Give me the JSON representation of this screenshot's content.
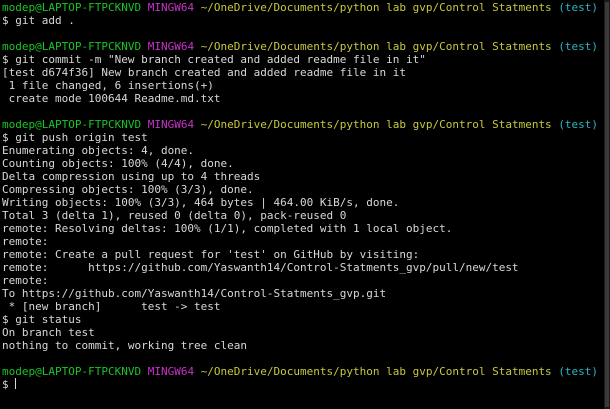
{
  "prompt": {
    "user_host": "modep@LAPTOP-FTPCKNVD",
    "shell": "MINGW64",
    "path": "~/OneDrive/Documents/python lab gvp/Control Statments",
    "branch": "(test)",
    "symbol": "$"
  },
  "blocks": [
    {
      "command": "git add .",
      "output": []
    },
    {
      "command": "git commit -m \"New branch created and added readme file in it\"",
      "output": [
        "[test d674f36] New branch created and added readme file in it",
        " 1 file changed, 6 insertions(+)",
        " create mode 100644 Readme.md.txt"
      ]
    },
    {
      "command": "git push origin test",
      "output": [
        "Enumerating objects: 4, done.",
        "Counting objects: 100% (4/4), done.",
        "Delta compression using up to 4 threads",
        "Compressing objects: 100% (3/3), done.",
        "Writing objects: 100% (3/3), 464 bytes | 464.00 KiB/s, done.",
        "Total 3 (delta 1), reused 0 (delta 0), pack-reused 0",
        "remote: Resolving deltas: 100% (1/1), completed with 1 local object.",
        "remote:",
        "remote: Create a pull request for 'test' on GitHub by visiting:",
        "remote:      https://github.com/Yaswanth14/Control-Statments_gvp/pull/new/test",
        "remote:",
        "To https://github.com/Yaswanth14/Control-Statments_gvp.git",
        " * [new branch]      test -> test"
      ]
    },
    {
      "command": "git status",
      "output": [
        "On branch test",
        "nothing to commit, working tree clean"
      ]
    }
  ],
  "colors": {
    "background": "#000000",
    "user_host": "#17c527",
    "shell": "#c832c8",
    "path": "#c8c83c",
    "branch": "#2cb5c6",
    "text": "#d8d8d8"
  }
}
